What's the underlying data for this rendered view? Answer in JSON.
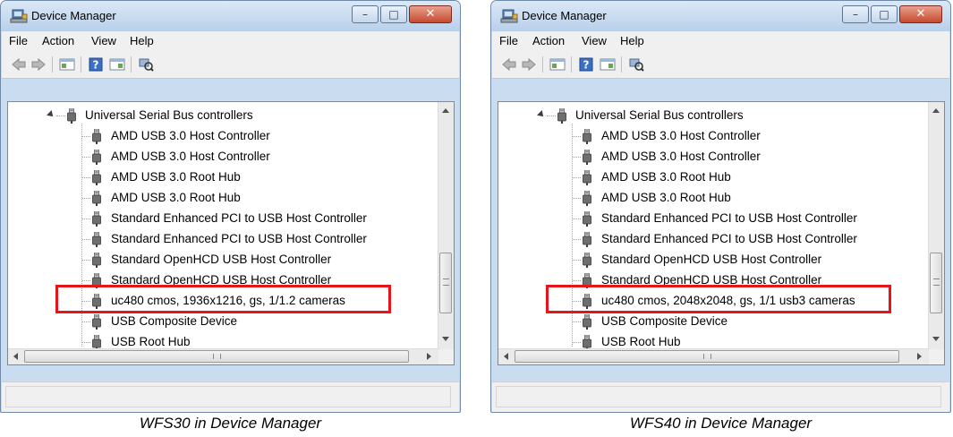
{
  "panels": [
    {
      "window_title": "Device Manager",
      "menu": [
        "File",
        "Action",
        "View",
        "Help"
      ],
      "window_controls": {
        "minimize": "–",
        "maximize": "□",
        "close": "✕"
      },
      "tree": {
        "category": "Universal Serial Bus controllers",
        "items": [
          "AMD USB 3.0 Host Controller",
          "AMD USB 3.0 Host Controller",
          "AMD USB 3.0 Root Hub",
          "AMD USB 3.0 Root Hub",
          "Standard Enhanced PCI to USB Host Controller",
          "Standard Enhanced PCI to USB Host Controller",
          "Standard OpenHCD USB Host Controller",
          "Standard OpenHCD USB Host Controller",
          "uc480 cmos, 1936x1216, gs, 1/1.2 cameras",
          "USB Composite Device",
          "USB Root Hub"
        ],
        "highlighted_index": 8
      },
      "caption": "WFS30 in Device Manager"
    },
    {
      "window_title": "Device Manager",
      "menu": [
        "File",
        "Action",
        "View",
        "Help"
      ],
      "window_controls": {
        "minimize": "–",
        "maximize": "□",
        "close": "✕"
      },
      "tree": {
        "category": "Universal Serial Bus controllers",
        "items": [
          "AMD USB 3.0 Host Controller",
          "AMD USB 3.0 Host Controller",
          "AMD USB 3.0 Root Hub",
          "AMD USB 3.0 Root Hub",
          "Standard Enhanced PCI to USB Host Controller",
          "Standard Enhanced PCI to USB Host Controller",
          "Standard OpenHCD USB Host Controller",
          "Standard OpenHCD USB Host Controller",
          "uc480 cmos, 2048x2048, gs, 1/1 usb3 cameras",
          "USB Composite Device",
          "USB Root Hub"
        ],
        "highlighted_index": 8
      },
      "caption": "WFS40 in Device Manager"
    }
  ],
  "icons": {
    "app": "device-manager-icon",
    "device": "usb-plug-icon",
    "toolbar": [
      "back-arrow-icon",
      "forward-arrow-icon",
      "show-hide-console-tree-icon",
      "help-icon",
      "properties-pane-icon",
      "scan-hardware-icon"
    ]
  },
  "colors": {
    "highlight": "#e8141c",
    "chrome": "#c9dcf0",
    "close_button": "#c44a30"
  }
}
